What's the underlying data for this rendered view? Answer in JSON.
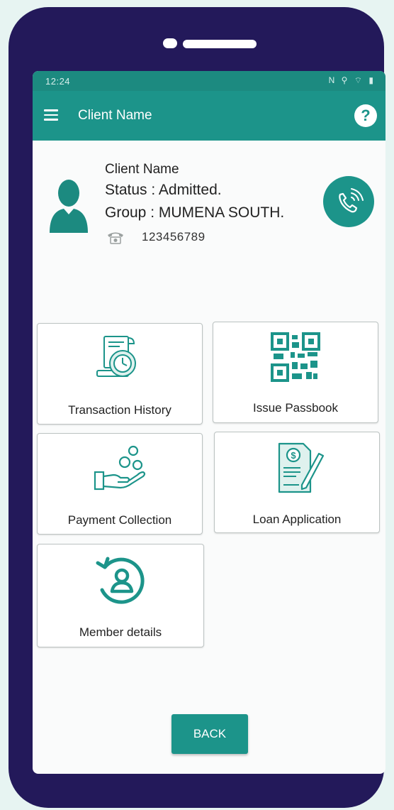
{
  "statusbar": {
    "time": "12:24",
    "icons": "N ⚲ ⌔ ▮"
  },
  "appbar": {
    "title": "Client Name",
    "help": "?"
  },
  "client": {
    "name": "Client Name",
    "status": "Status : Admitted.",
    "group": "Group : MUMENA SOUTH.",
    "phone": "123456789"
  },
  "tiles": [
    {
      "label": "Transaction History",
      "icon": "transaction-history-icon"
    },
    {
      "label": "Issue Passbook",
      "icon": "qr-code-icon"
    },
    {
      "label": "Payment Collection",
      "icon": "payment-collection-icon"
    },
    {
      "label": "Loan Application",
      "icon": "loan-application-icon"
    },
    {
      "label": "Member details",
      "icon": "member-details-icon"
    }
  ],
  "back_button": "BACK",
  "colors": {
    "primary": "#1c948a",
    "frame": "#23195a",
    "background": "#e7f4f2"
  }
}
